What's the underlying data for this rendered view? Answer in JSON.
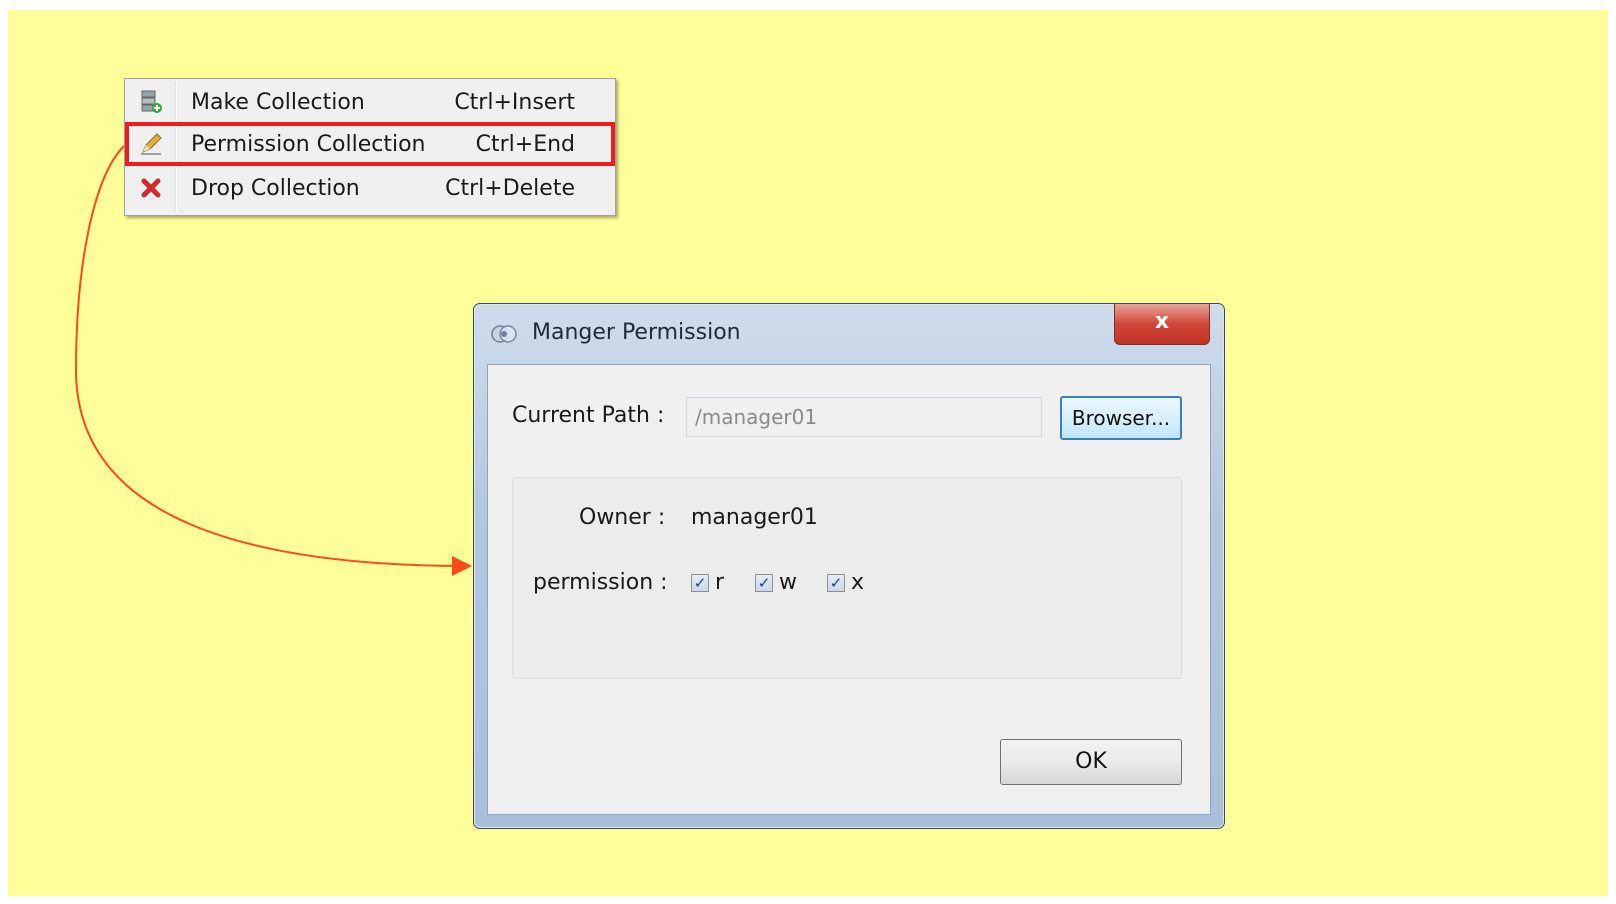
{
  "menu": {
    "items": [
      {
        "label": "Make Collection",
        "shortcut": "Ctrl+Insert",
        "icon": "server-add-icon"
      },
      {
        "label": "Permission Collection",
        "shortcut": "Ctrl+End",
        "icon": "pencil-icon"
      },
      {
        "label": "Drop Collection",
        "shortcut": "Ctrl+Delete",
        "icon": "red-x-icon"
      }
    ]
  },
  "dialog": {
    "title": "Manger Permission",
    "close_label": "x",
    "current_path_label": "Current Path :",
    "current_path_value": "/manager01",
    "browser_label": "Browser...",
    "owner_label": "Owner :",
    "owner_value": "manager01",
    "permission_label": "permission :",
    "permissions": [
      {
        "label": "r",
        "checked": true
      },
      {
        "label": "w",
        "checked": true
      },
      {
        "label": "x",
        "checked": true
      }
    ],
    "ok_label": "OK"
  },
  "colors": {
    "slide_background": "#ffff99",
    "highlight": "#ee1c1c",
    "connector": "#ff4a1a"
  }
}
